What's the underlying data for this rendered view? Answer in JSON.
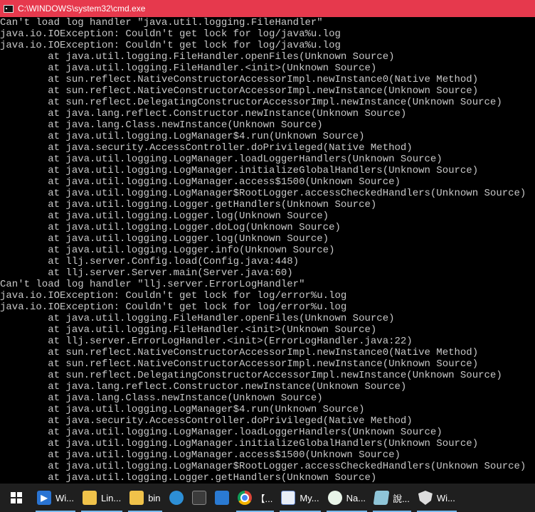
{
  "window": {
    "title": "C:\\WINDOWS\\system32\\cmd.exe",
    "icon": "cmd-icon"
  },
  "console": {
    "lines": [
      "Can't load log handler \"java.util.logging.FileHandler\"",
      "java.io.IOException: Couldn't get lock for log/java%u.log",
      "java.io.IOException: Couldn't get lock for log/java%u.log",
      "        at java.util.logging.FileHandler.openFiles(Unknown Source)",
      "        at java.util.logging.FileHandler.<init>(Unknown Source)",
      "        at sun.reflect.NativeConstructorAccessorImpl.newInstance0(Native Method)",
      "        at sun.reflect.NativeConstructorAccessorImpl.newInstance(Unknown Source)",
      "        at sun.reflect.DelegatingConstructorAccessorImpl.newInstance(Unknown Source)",
      "        at java.lang.reflect.Constructor.newInstance(Unknown Source)",
      "        at java.lang.Class.newInstance(Unknown Source)",
      "        at java.util.logging.LogManager$4.run(Unknown Source)",
      "        at java.security.AccessController.doPrivileged(Native Method)",
      "        at java.util.logging.LogManager.loadLoggerHandlers(Unknown Source)",
      "        at java.util.logging.LogManager.initializeGlobalHandlers(Unknown Source)",
      "        at java.util.logging.LogManager.access$1500(Unknown Source)",
      "        at java.util.logging.LogManager$RootLogger.accessCheckedHandlers(Unknown Source)",
      "        at java.util.logging.Logger.getHandlers(Unknown Source)",
      "        at java.util.logging.Logger.log(Unknown Source)",
      "        at java.util.logging.Logger.doLog(Unknown Source)",
      "        at java.util.logging.Logger.log(Unknown Source)",
      "        at java.util.logging.Logger.info(Unknown Source)",
      "        at llj.server.Config.load(Config.java:448)",
      "        at llj.server.Server.main(Server.java:60)",
      "Can't load log handler \"llj.server.ErrorLogHandler\"",
      "java.io.IOException: Couldn't get lock for log/error%u.log",
      "java.io.IOException: Couldn't get lock for log/error%u.log",
      "        at java.util.logging.FileHandler.openFiles(Unknown Source)",
      "        at java.util.logging.FileHandler.<init>(Unknown Source)",
      "        at llj.server.ErrorLogHandler.<init>(ErrorLogHandler.java:22)",
      "        at sun.reflect.NativeConstructorAccessorImpl.newInstance0(Native Method)",
      "        at sun.reflect.NativeConstructorAccessorImpl.newInstance(Unknown Source)",
      "        at sun.reflect.DelegatingConstructorAccessorImpl.newInstance(Unknown Source)",
      "        at java.lang.reflect.Constructor.newInstance(Unknown Source)",
      "        at java.lang.Class.newInstance(Unknown Source)",
      "        at java.util.logging.LogManager$4.run(Unknown Source)",
      "        at java.security.AccessController.doPrivileged(Native Method)",
      "        at java.util.logging.LogManager.loadLoggerHandlers(Unknown Source)",
      "        at java.util.logging.LogManager.initializeGlobalHandlers(Unknown Source)",
      "        at java.util.logging.LogManager.access$1500(Unknown Source)",
      "        at java.util.logging.LogManager$RootLogger.accessCheckedHandlers(Unknown Source)",
      "        at java.util.logging.Logger.getHandlers(Unknown Source)"
    ]
  },
  "taskbar": {
    "items": [
      {
        "label": "Wi...",
        "icon": "media-player-icon",
        "open": true
      },
      {
        "label": "Lin...",
        "icon": "folder-icon",
        "open": true
      },
      {
        "label": "bin",
        "icon": "folder-icon",
        "open": true
      },
      {
        "label": "",
        "icon": "edge-icon",
        "open": false
      },
      {
        "label": "",
        "icon": "calculator-icon",
        "open": false
      },
      {
        "label": "",
        "icon": "mail-icon",
        "open": false
      },
      {
        "label": "【...",
        "icon": "chrome-icon",
        "open": true
      },
      {
        "label": "My...",
        "icon": "chart-app-icon",
        "open": true
      },
      {
        "label": "Na...",
        "icon": "navicat-icon",
        "open": true
      },
      {
        "label": "說...",
        "icon": "notepad-icon",
        "open": true
      },
      {
        "label": "Wi...",
        "icon": "shield-icon",
        "open": true
      }
    ]
  },
  "colors": {
    "titlebar": "#e6394d",
    "console_bg": "#000000",
    "console_text": "#c8c8c8",
    "taskbar": "#1f1f1f",
    "taskbar_active_underline": "#76b9ed"
  }
}
